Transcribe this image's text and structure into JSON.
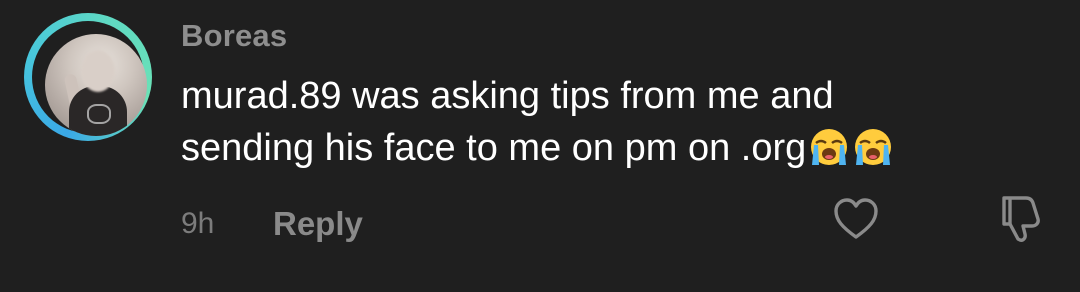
{
  "comment": {
    "username": "Boreas",
    "text_line1": "murad.89 was asking tips from me and",
    "text_line2": "sending his face to me on pm on .org",
    "emojis": [
      "crying-face-emoji",
      "crying-face-emoji"
    ],
    "timestamp": "9h",
    "reply_label": "Reply"
  },
  "icons": {
    "like": "heart-outline-icon",
    "dislike": "thumbs-down-outline-icon"
  },
  "colors": {
    "background": "#1f1f1f",
    "text": "#ffffff",
    "username": "#8e8e8e",
    "meta": "#7c7c7c",
    "ring_start": "#3aa8e6",
    "ring_end": "#6be2b6"
  }
}
